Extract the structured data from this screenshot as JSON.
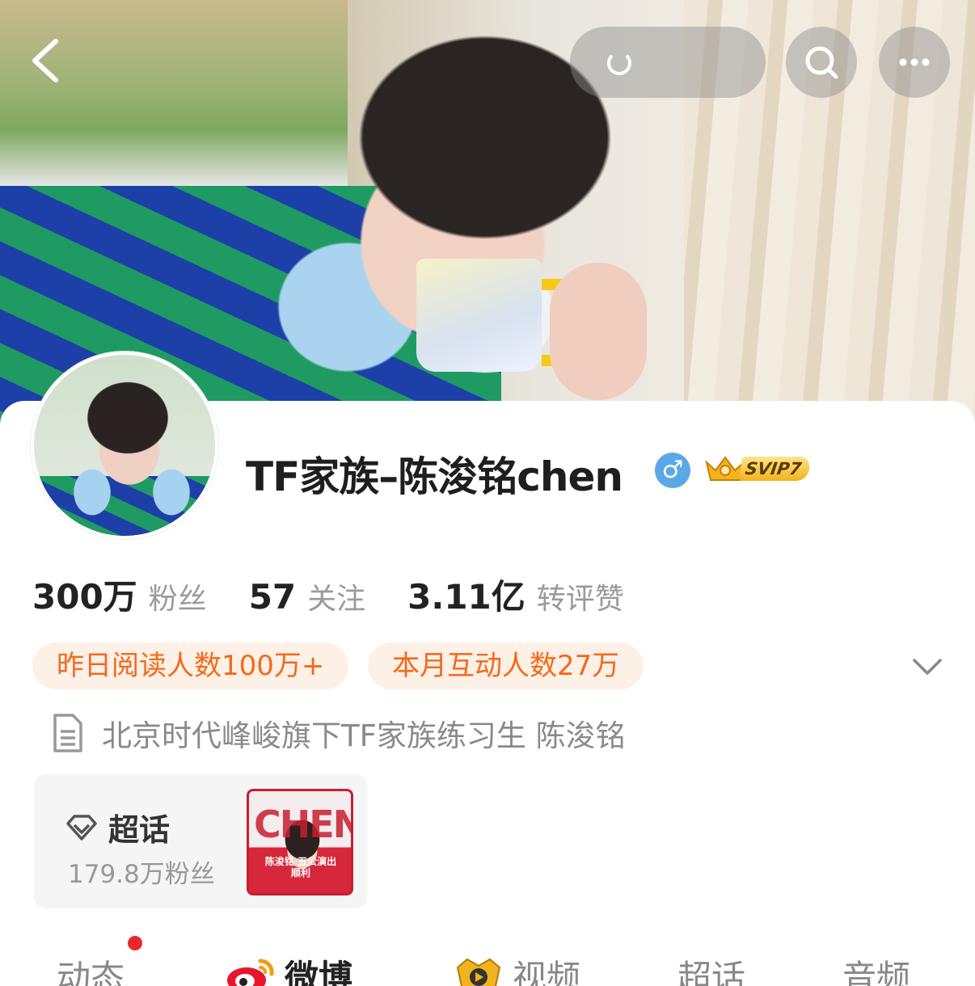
{
  "profile": {
    "name": "TF家族–陈浚铭chen",
    "gender_symbol": "♂",
    "svip_label": "SVIP7",
    "bio": "北京时代峰峻旗下TF家族练习生  陈浚铭"
  },
  "stats": [
    {
      "value": "300万",
      "label": "粉丝"
    },
    {
      "value": "57",
      "label": "关注"
    },
    {
      "value": "3.11亿",
      "label": "转评赞"
    }
  ],
  "chips": {
    "reads": "昨日阅读人数100万+",
    "interactions": "本月互动人数27万"
  },
  "super_topic": {
    "title": "超话",
    "fans": "179.8万粉丝",
    "poster_big_text": "CHEN",
    "poster_caption": "陈浚铭 五公演出顺利"
  },
  "tabs": [
    {
      "label": "动态",
      "icon": "",
      "active": false
    },
    {
      "label": "微博",
      "icon": "weibo-icon",
      "active": true
    },
    {
      "label": "视频",
      "icon": "video-play-icon",
      "active": false
    },
    {
      "label": "超话",
      "icon": "",
      "active": false
    },
    {
      "label": "音频",
      "icon": "",
      "active": false
    }
  ],
  "colors": {
    "accent_orange": "#f26a1b",
    "chip_bg": "#fdf0e6",
    "notification_dot": "#e8282b",
    "gender_blue": "#5aa9e6"
  }
}
